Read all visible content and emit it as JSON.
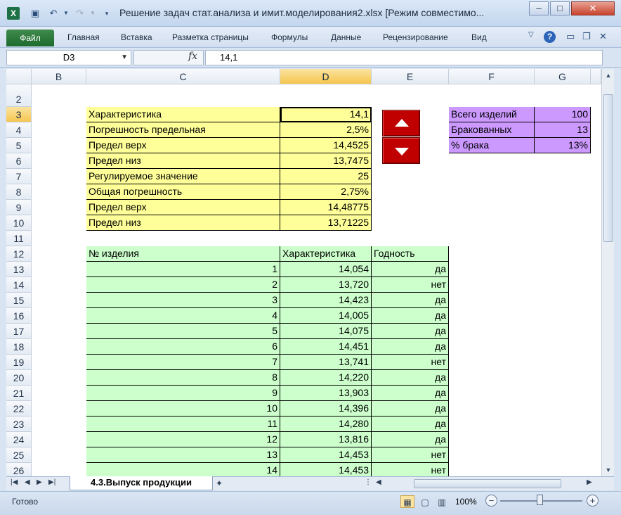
{
  "app": {
    "title": "Решение задач стат.анализа и имит.моделирования2.xlsx  [Режим совместимо...",
    "excel_icon_letter": "X"
  },
  "window_controls": {
    "minimize": "–",
    "maximize": "□",
    "close": "✕"
  },
  "ribbon": {
    "file": "Файл",
    "tabs": [
      "Главная",
      "Вставка",
      "Разметка страницы",
      "Формулы",
      "Данные",
      "Рецензирование",
      "Вид"
    ],
    "help": "?"
  },
  "formula_bar": {
    "name_box": "D3",
    "fx": "fx",
    "formula": "14,1"
  },
  "columns": [
    "B",
    "C",
    "D",
    "E",
    "F",
    "G"
  ],
  "rows": [
    "2",
    "3",
    "4",
    "5",
    "6",
    "7",
    "8",
    "9",
    "10",
    "11",
    "12",
    "13",
    "14",
    "15",
    "16",
    "17",
    "18",
    "19",
    "20",
    "21",
    "22",
    "23",
    "24",
    "25",
    "26"
  ],
  "params": [
    {
      "label": "Характеристика",
      "value": "14,1"
    },
    {
      "label": "Погрешность предельная",
      "value": "2,5%"
    },
    {
      "label": "Предел верх",
      "value": "14,4525"
    },
    {
      "label": "Предел низ",
      "value": "13,7475"
    },
    {
      "label": "Регулируемое значение",
      "value": "25"
    },
    {
      "label": "Общая погрешность",
      "value": "2,75%"
    },
    {
      "label": "Предел верх",
      "value": "14,48775"
    },
    {
      "label": "Предел низ",
      "value": "13,71225"
    }
  ],
  "summary": [
    {
      "label": "Всего изделий",
      "value": "100"
    },
    {
      "label": "Бракованных",
      "value": "13"
    },
    {
      "label": "% брака",
      "value": "13%"
    }
  ],
  "table": {
    "headers": [
      "№ изделия",
      "Характеристика",
      "Годность"
    ],
    "rows": [
      [
        "1",
        "14,054",
        "да"
      ],
      [
        "2",
        "13,720",
        "нет"
      ],
      [
        "3",
        "14,423",
        "да"
      ],
      [
        "4",
        "14,005",
        "да"
      ],
      [
        "5",
        "14,075",
        "да"
      ],
      [
        "6",
        "14,451",
        "да"
      ],
      [
        "7",
        "13,741",
        "нет"
      ],
      [
        "8",
        "14,220",
        "да"
      ],
      [
        "9",
        "13,903",
        "да"
      ],
      [
        "10",
        "14,396",
        "да"
      ],
      [
        "11",
        "14,280",
        "да"
      ],
      [
        "12",
        "13,816",
        "да"
      ],
      [
        "13",
        "14,453",
        "нет"
      ],
      [
        "14",
        "14,453",
        "нет"
      ]
    ]
  },
  "sheet": {
    "tab": "4.3.Выпуск продукции"
  },
  "status": {
    "ready": "Готово",
    "zoom": "100%",
    "zoom_minus": "−",
    "zoom_plus": "+"
  },
  "colors": {
    "yellow": "#ffff99",
    "green": "#ccffcc",
    "purple": "#cc99ff",
    "spin_button": "#c00000"
  }
}
